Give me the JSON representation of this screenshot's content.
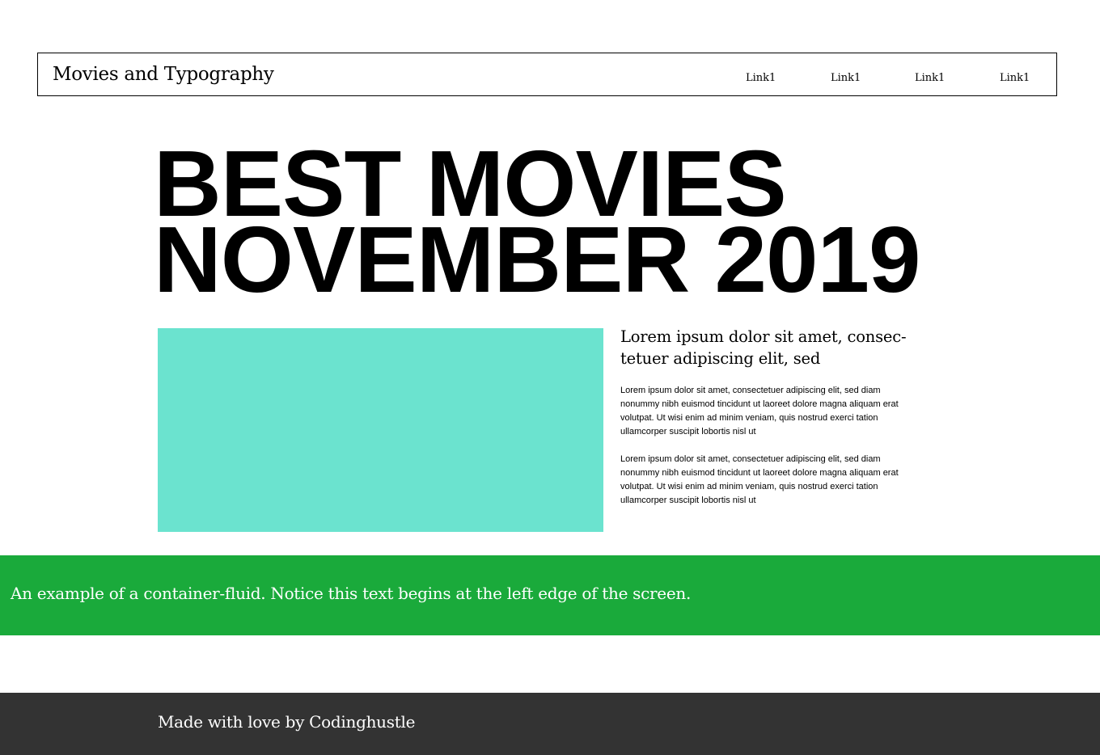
{
  "navbar": {
    "brand": "Movies and Typography",
    "links": [
      "Link1",
      "Link1",
      "Link1",
      "Link1"
    ]
  },
  "hero": {
    "title_line1": "BEST MOVIES",
    "title_line2": "NOVEMBER 2019"
  },
  "article": {
    "lead": "Lorem ipsum dolor sit amet, consec-tetuer adipiscing elit, sed",
    "paragraphs": [
      "Lorem ipsum dolor sit amet, consectetuer adipiscing elit, sed diam nonummy nibh euismod tincidunt ut laoreet dolore magna aliquam erat volutpat. Ut wisi enim ad minim veniam, quis nostrud exerci tation ullamcorper suscipit lobortis nisl ut",
      "Lorem ipsum dolor sit amet, consectetuer adipiscing elit, sed diam nonummy nibh euismod tincidunt ut laoreet dolore magna aliquam erat volutpat. Ut wisi enim ad minim veniam, quis nostrud exerci tation ullamcorper suscipit lobortis nisl ut"
    ]
  },
  "fluid_section": {
    "text": "An example of a container-fluid. Notice this text begins at the left edge of the screen."
  },
  "footer": {
    "text": "Made with love by Codinghustle"
  },
  "colors": {
    "image_placeholder": "#6be3cf",
    "fluid_band": "#1aaa3b",
    "footer": "#333333"
  }
}
